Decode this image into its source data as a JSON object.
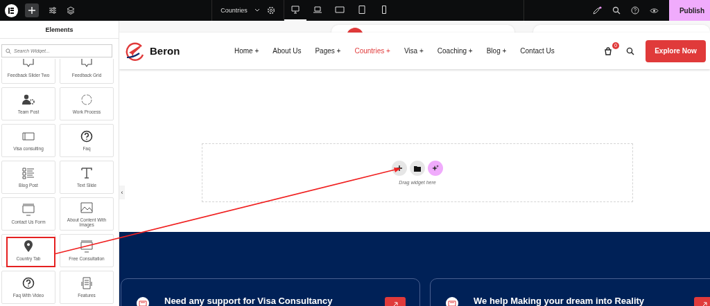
{
  "topbar": {
    "document": "Countries",
    "devices": [
      {
        "kind": "desktop",
        "selected": true
      },
      {
        "kind": "laptop",
        "selected": false
      },
      {
        "kind": "tablet-landscape",
        "selected": false
      },
      {
        "kind": "tablet",
        "selected": false
      },
      {
        "kind": "mobile",
        "selected": false
      }
    ],
    "publish": "Publish"
  },
  "sidebar": {
    "title": "Elements",
    "search": {
      "placeholder": "Search Widget..."
    },
    "widgets": [
      {
        "label": "Feedback Slider Two",
        "kind": "comment",
        "highlighted": false
      },
      {
        "label": "Feedback Grid",
        "kind": "comment",
        "highlighted": false
      },
      {
        "label": "Team Post",
        "kind": "team",
        "highlighted": false
      },
      {
        "label": "Work Process",
        "kind": "counter",
        "highlighted": false
      },
      {
        "label": "Visa consulting",
        "kind": "panel",
        "highlighted": false
      },
      {
        "label": "Faq",
        "kind": "question",
        "highlighted": false
      },
      {
        "label": "Blog Post",
        "kind": "list",
        "highlighted": false
      },
      {
        "label": "Text Slide",
        "kind": "text",
        "highlighted": false
      },
      {
        "label": "Contact Us Form",
        "kind": "form",
        "highlighted": false
      },
      {
        "label": "About Content With Images",
        "kind": "image",
        "highlighted": false
      },
      {
        "label": "Country Tab",
        "kind": "pin",
        "highlighted": true
      },
      {
        "label": "Free Consultation",
        "kind": "form",
        "highlighted": false
      },
      {
        "label": "Faq With Video",
        "kind": "question",
        "highlighted": false
      },
      {
        "label": "Features",
        "kind": "doc",
        "highlighted": false
      }
    ],
    "collapse": "‹"
  },
  "header": {
    "logo": "Beron",
    "nav": [
      {
        "label": "Home",
        "marker": "+",
        "selected": false
      },
      {
        "label": "About Us",
        "selected": false
      },
      {
        "label": "Pages",
        "marker": "+",
        "selected": false
      },
      {
        "label": "Countries",
        "marker": "+",
        "selected": true
      },
      {
        "label": "Visa",
        "marker": "+",
        "selected": false
      },
      {
        "label": "Coaching",
        "marker": "+",
        "selected": false
      },
      {
        "label": "Blog",
        "marker": "+",
        "selected": false
      },
      {
        "label": "Contact Us",
        "selected": false
      }
    ],
    "cart_count": "0",
    "cta": "Explore Now"
  },
  "dropzone": {
    "hint": "Drag widget here"
  },
  "cards": [
    {
      "title": "Need any support for Visa Consultancy"
    },
    {
      "title": "We help Making your dream into Reality"
    }
  ]
}
